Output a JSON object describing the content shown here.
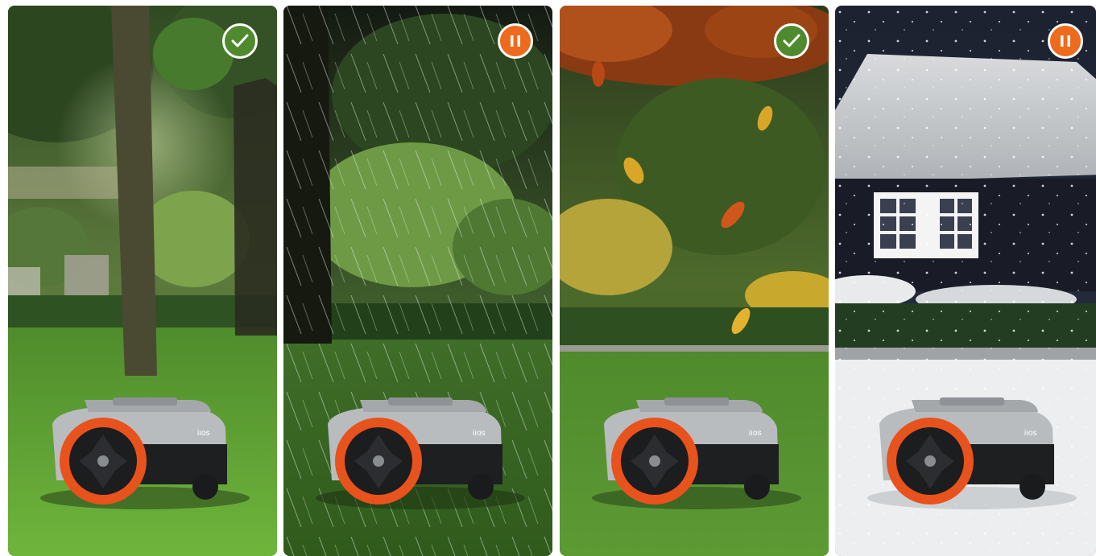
{
  "panels": [
    {
      "scene": "Sunny",
      "status_icon": "check-icon",
      "status_color": "#4f8a2e",
      "brand_text": "iıos"
    },
    {
      "scene": "Rain",
      "status_icon": "pause-icon",
      "status_color": "#ee6a1c",
      "brand_text": "iıos"
    },
    {
      "scene": "Autumn",
      "status_icon": "check-icon",
      "status_color": "#4f8a2e",
      "brand_text": "iıos"
    },
    {
      "scene": "Snow",
      "status_icon": "pause-icon",
      "status_color": "#ee6a1c",
      "brand_text": "iıos"
    }
  ],
  "colors": {
    "wheel": "#e8521c",
    "body": "#b9bcbf",
    "grass": "#6aa63a"
  }
}
